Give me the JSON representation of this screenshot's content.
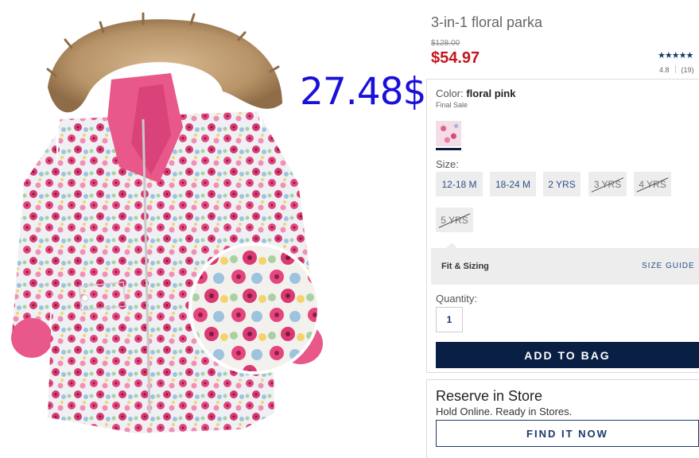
{
  "overlay": {
    "annotation_price": "27.48$"
  },
  "product": {
    "title": "3-in-1 floral parka",
    "original_price": "$128.00",
    "sale_price": "$54.97",
    "rating": {
      "stars": "★★★★★",
      "value": "4.8",
      "count": "(19)"
    }
  },
  "color": {
    "label": "Color:",
    "value": "floral pink",
    "note": "Final Sale"
  },
  "sizes": {
    "label": "Size:",
    "options": [
      {
        "label": "12-18 M",
        "available": true
      },
      {
        "label": "18-24 M",
        "available": true
      },
      {
        "label": "2 YRS",
        "available": true
      },
      {
        "label": "3 YRS",
        "available": false
      },
      {
        "label": "4 YRS",
        "available": false
      },
      {
        "label": "5 YRS",
        "available": false
      }
    ]
  },
  "fit": {
    "label": "Fit & Sizing",
    "guide_link": "SIZE GUIDE"
  },
  "quantity": {
    "label": "Quantity:",
    "value": "1"
  },
  "actions": {
    "add_to_bag": "ADD TO BAG"
  },
  "reserve": {
    "title": "Reserve in Store",
    "subtitle": "Hold Online. Ready in Stores.",
    "button": "FIND IT NOW"
  },
  "colors": {
    "sale_red": "#c4161c",
    "navy": "#0a1f44",
    "link_blue": "#2c4f8a",
    "annotation_blue": "#1a10d8",
    "parka_pink": "#e8588a",
    "fur": "#b89468"
  }
}
